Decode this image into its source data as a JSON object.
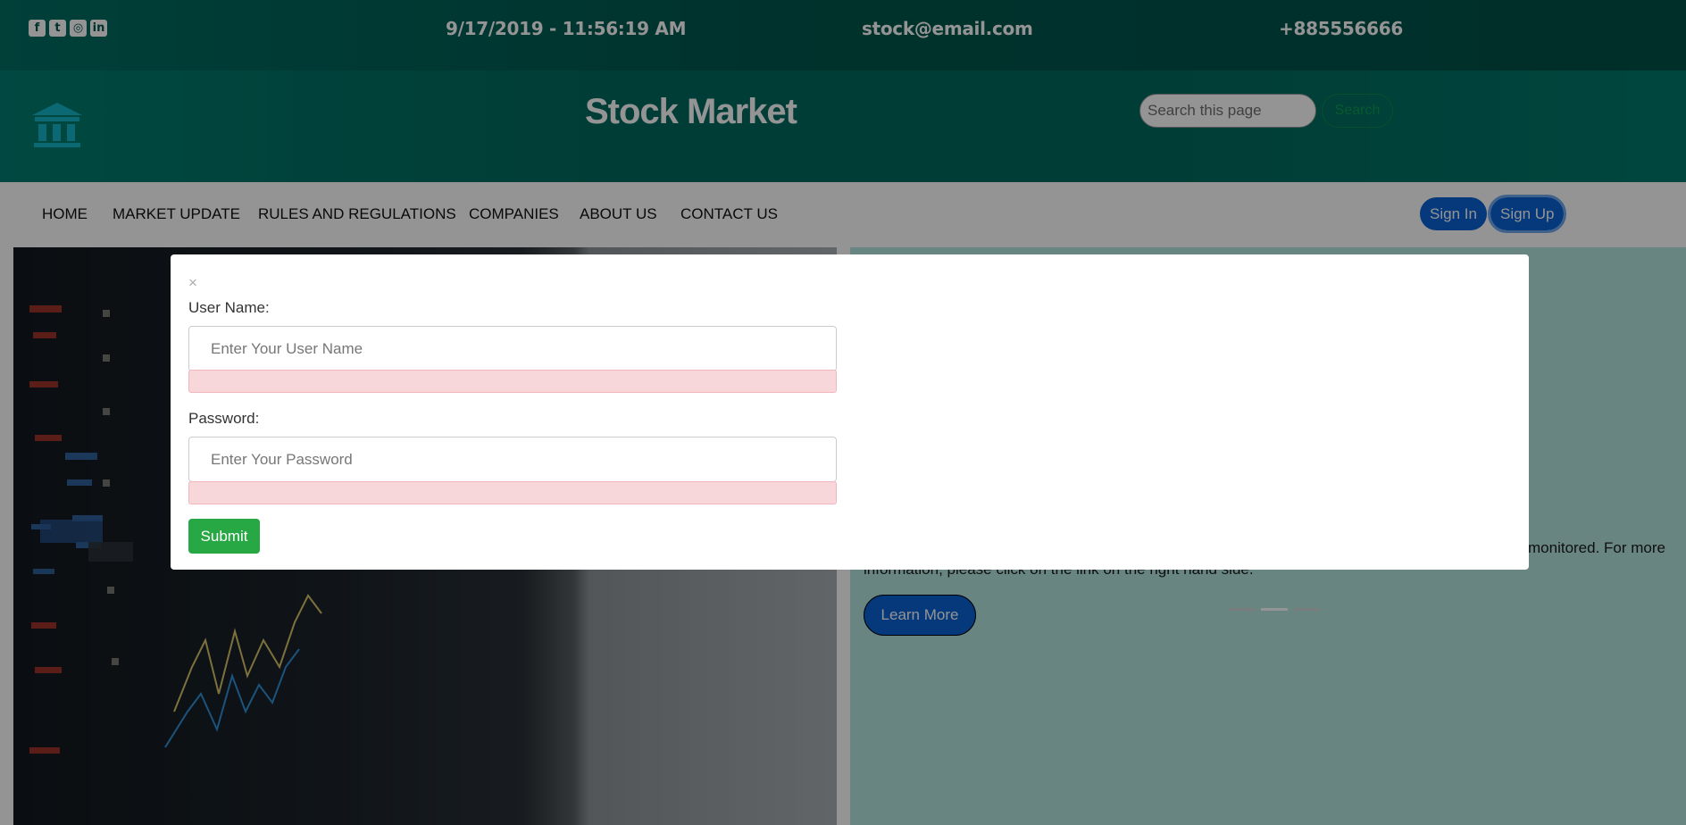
{
  "topbar": {
    "social_icons": [
      "facebook-icon",
      "twitter-icon",
      "instagram-icon",
      "linkedin-icon"
    ],
    "social_glyphs": [
      "f",
      "t",
      "◎",
      "in"
    ],
    "datetime": "9/17/2019 - 11:56:19 AM",
    "email": "stock@email.com",
    "phone": "+885556666"
  },
  "header": {
    "logo_icon": "bank-icon",
    "title": "Stock Market",
    "search_placeholder": "Search this page",
    "search_button": "Search"
  },
  "nav": {
    "items": [
      "HOME",
      "MARKET UPDATE",
      "RULES AND REGULATIONS",
      "COMPANIES",
      "ABOUT US",
      "CONTACT US"
    ],
    "sign_in": "Sign In",
    "sign_up": "Sign Up"
  },
  "hero": {
    "text_line1": "monitored. For more",
    "text_line2": "information, please click on the link on the right hand side.",
    "learn_more": "Learn More",
    "active_slide": 2
  },
  "modal": {
    "close": "×",
    "username_label": "User Name:",
    "username_placeholder": "Enter Your User Name",
    "password_label": "Password:",
    "password_placeholder": "Enter Your Password",
    "submit": "Submit"
  },
  "colors": {
    "topbar": "#005148",
    "header": "#006a5e",
    "primary_button": "#0a62d6",
    "submit_button": "#28a745",
    "error_bg": "#f8d7da"
  }
}
